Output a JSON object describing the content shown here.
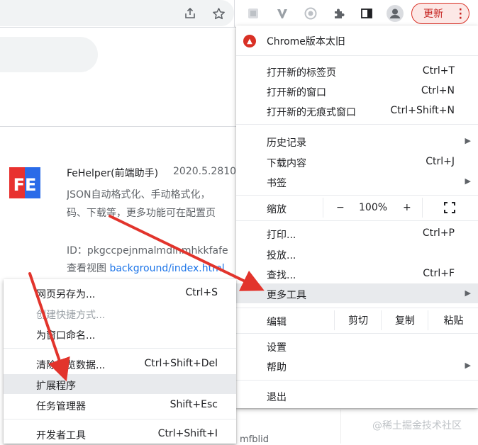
{
  "toolbar": {
    "update_label": "更新",
    "icons": [
      "share-icon",
      "star-icon",
      "ext-gray-icon",
      "ext-v-icon",
      "ext-camera-icon",
      "puzzle-icon",
      "sidepanel-icon",
      "profile-icon",
      "kebab-icon"
    ]
  },
  "extension": {
    "name": "FeHelper(前端助手)",
    "version": "2020.5.2810",
    "description_line1": "JSON自动格式化、手动格式化，",
    "description_line2": "码、下载等，更多功能可在配置页",
    "id_label": "ID：pkgccpejnmalmdinmhkkfafe",
    "view_label": "查看视图",
    "view_link": "background/index.html",
    "logo_text": "FE"
  },
  "page_fragment": "mfblid",
  "main_menu": {
    "update_notice": "Chrome版本太旧",
    "new_tab": {
      "label": "打开新的标签页",
      "shortcut": "Ctrl+T"
    },
    "new_window": {
      "label": "打开新的窗口",
      "shortcut": "Ctrl+N"
    },
    "incognito": {
      "label": "打开新的无痕式窗口",
      "shortcut": "Ctrl+Shift+N"
    },
    "history": {
      "label": "历史记录"
    },
    "downloads": {
      "label": "下载内容",
      "shortcut": "Ctrl+J"
    },
    "bookmarks": {
      "label": "书签"
    },
    "zoom": {
      "label": "缩放",
      "minus": "−",
      "value": "100%",
      "plus": "+"
    },
    "print": {
      "label": "打印...",
      "shortcut": "Ctrl+P"
    },
    "cast": {
      "label": "投放..."
    },
    "find": {
      "label": "查找...",
      "shortcut": "Ctrl+F"
    },
    "more_tools": {
      "label": "更多工具"
    },
    "edit": {
      "label": "编辑",
      "cut": "剪切",
      "copy": "复制",
      "paste": "粘贴"
    },
    "settings": {
      "label": "设置"
    },
    "help": {
      "label": "帮助"
    },
    "exit": {
      "label": "退出"
    }
  },
  "sub_menu": {
    "save_page": {
      "label": "网页另存为...",
      "shortcut": "Ctrl+S"
    },
    "create_shortcut": {
      "label": "创建快捷方式..."
    },
    "name_window": {
      "label": "为窗口命名..."
    },
    "clear_data": {
      "label": "清除浏览数据...",
      "shortcut": "Ctrl+Shift+Del"
    },
    "extensions": {
      "label": "扩展程序"
    },
    "task_manager": {
      "label": "任务管理器",
      "shortcut": "Shift+Esc"
    },
    "dev_tools": {
      "label": "开发者工具",
      "shortcut": "Ctrl+Shift+I"
    }
  },
  "watermark": "@稀土掘金技术社区",
  "colors": {
    "arrow": "#e2342c",
    "update_bg": "#fce8e6",
    "update_text": "#c5221f",
    "highlight": "#e8eaed",
    "fe_red": "#e8312f",
    "fe_blue": "#2a6be8"
  }
}
